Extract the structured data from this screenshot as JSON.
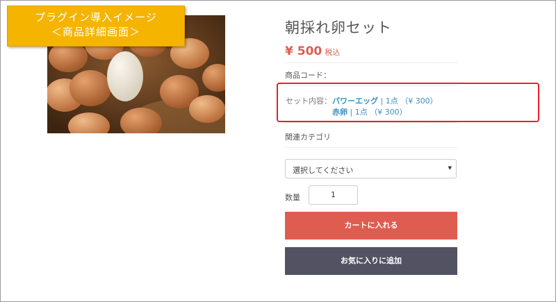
{
  "banner": {
    "line1": "プラグイン導入イメージ",
    "line2": "＜商品詳細画面＞"
  },
  "product": {
    "name": "朝採れ卵セット",
    "price": "¥ 500",
    "tax_label": "税込",
    "code_label": "商品コード：",
    "set_label": "セット内容：",
    "set_items": [
      {
        "name": "パワーエッグ",
        "detail": " | 1点 （¥ 300）"
      },
      {
        "name": "赤卵",
        "detail": " | 1点 （¥ 300）"
      }
    ],
    "category_label": "関連カテゴリ"
  },
  "form": {
    "select_placeholder": "選択してください",
    "select_arrow": "▼",
    "qty_label": "数量",
    "qty_value": "1"
  },
  "buttons": {
    "cart": "カートに入れる",
    "favorite": "お気に入りに追加"
  },
  "colors": {
    "accent": "#de5d50",
    "link": "#3d8fc2",
    "highlight_border": "#e8202a",
    "banner": "#f5b400",
    "favorite_button": "#525263"
  }
}
